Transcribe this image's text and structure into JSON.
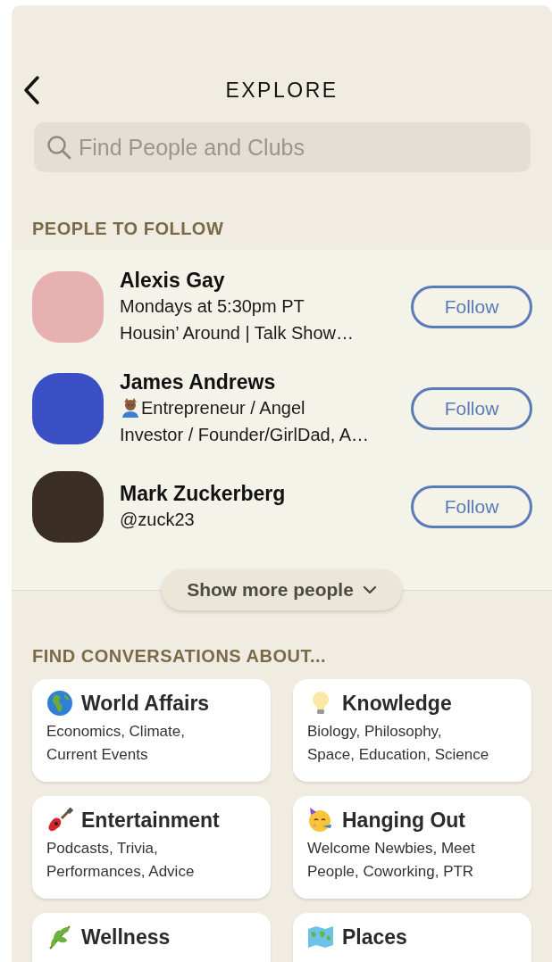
{
  "header": {
    "title": "EXPLORE"
  },
  "search": {
    "placeholder": "Find People and Clubs"
  },
  "people_section": {
    "title": "PEOPLE TO FOLLOW",
    "people": [
      {
        "name": "Alexis Gay",
        "lines": [
          "Mondays at 5:30pm PT",
          "Housin’ Around | Talk Show…"
        ],
        "bio_emoji": false,
        "button": "Follow"
      },
      {
        "name": "James Andrews",
        "lines": [
          "Entrepreneur / Angel\nInvestor / Founder/GirlDad, A…"
        ],
        "bio_emoji": true,
        "button": "Follow"
      },
      {
        "name": "Mark Zuckerberg",
        "lines": [
          "@zuck23"
        ],
        "bio_emoji": false,
        "button": "Follow"
      }
    ],
    "show_more": "Show more people"
  },
  "topics_section": {
    "title": "FIND CONVERSATIONS ABOUT...",
    "topics": [
      {
        "title": "World Affairs",
        "subtitle": "Economics, Climate,\nCurrent Events"
      },
      {
        "title": "Knowledge",
        "subtitle": "Biology, Philosophy,\nSpace, Education, Science"
      },
      {
        "title": "Entertainment",
        "subtitle": "Podcasts, Trivia,\nPerformances, Advice"
      },
      {
        "title": "Hanging Out",
        "subtitle": "Welcome Newbies, Meet\nPeople, Coworking, PTR"
      },
      {
        "title": "Wellness"
      },
      {
        "title": "Places"
      }
    ]
  }
}
